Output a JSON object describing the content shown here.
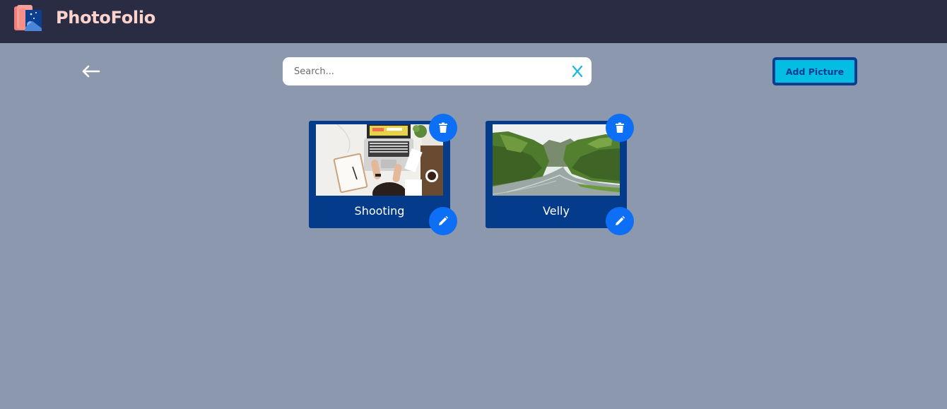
{
  "navbar": {
    "brand": "PhotoFolio",
    "logo_icon": "photo-album-icon",
    "background": "#292c42",
    "brand_color": "#fcd3cc"
  },
  "toolbar": {
    "back_icon": "arrow-left-icon",
    "search": {
      "placeholder": "Search...",
      "value": "",
      "clear_icon": "close-icon"
    },
    "add_button_label": "Add Picture"
  },
  "images": [
    {
      "title": "Shooting",
      "thumbnail": "laptop-desk-photo",
      "delete_icon": "trash-icon",
      "edit_icon": "pencil-icon"
    },
    {
      "title": "Velly",
      "thumbnail": "canyon-river-photo",
      "delete_icon": "trash-icon",
      "edit_icon": "pencil-icon"
    }
  ],
  "colors": {
    "page_background": "#8c98ad",
    "card": "#053b8b",
    "action_button": "#0d6ef6",
    "add_button": "#03bde2",
    "add_button_border": "#0a3d8f"
  }
}
